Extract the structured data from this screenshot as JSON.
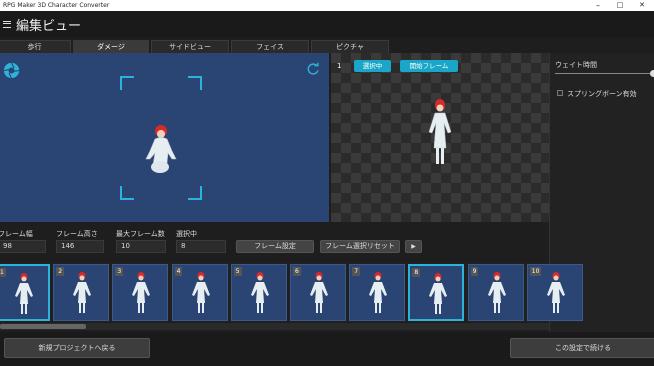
{
  "window": {
    "title": "RPG Maker 3D Character Converter",
    "controls": [
      "–",
      "□",
      "✕"
    ]
  },
  "header": {
    "title": "編集ビュー"
  },
  "tabs": [
    {
      "label": "歩行",
      "active": false
    },
    {
      "label": "ダメージ",
      "active": true
    },
    {
      "label": "サイドビュー",
      "active": false
    },
    {
      "label": "フェイス",
      "active": false
    },
    {
      "label": "ピクチャ",
      "active": false
    }
  ],
  "preview": {
    "frame_number": "1",
    "selected_label": "選択中",
    "start_frame_label": "開始フレーム"
  },
  "side_panel": {
    "wait_label": "ウェイト時間",
    "spring_bone_label": "スプリングボーン有効"
  },
  "settings": {
    "frame_width_label": "フレーム幅",
    "frame_width": "98",
    "frame_height_label": "フレーム高さ",
    "frame_height": "146",
    "max_frames_label": "最大フレーム数",
    "max_frames": "10",
    "selected_label": "選択中",
    "selected": "8",
    "frame_settings_button": "フレーム設定",
    "reset_selection_button": "フレーム選択リセット",
    "play_glyph": "▶"
  },
  "frames": [
    {
      "num": "1",
      "selected": true
    },
    {
      "num": "2",
      "selected": false
    },
    {
      "num": "3",
      "selected": false
    },
    {
      "num": "4",
      "selected": false
    },
    {
      "num": "5",
      "selected": false
    },
    {
      "num": "6",
      "selected": false
    },
    {
      "num": "7",
      "selected": false
    },
    {
      "num": "8",
      "selected": true
    },
    {
      "num": "9",
      "selected": false
    },
    {
      "num": "10",
      "selected": false
    }
  ],
  "footer": {
    "back_button": "新規プロジェクトへ戻る",
    "continue_button": "この設定で続ける"
  },
  "colors": {
    "accent": "#2db3d9",
    "viewport": "#2a4574"
  },
  "icons": {
    "camera": "aperture-icon",
    "rotate": "refresh-icon",
    "menu": "hamburger-icon"
  }
}
